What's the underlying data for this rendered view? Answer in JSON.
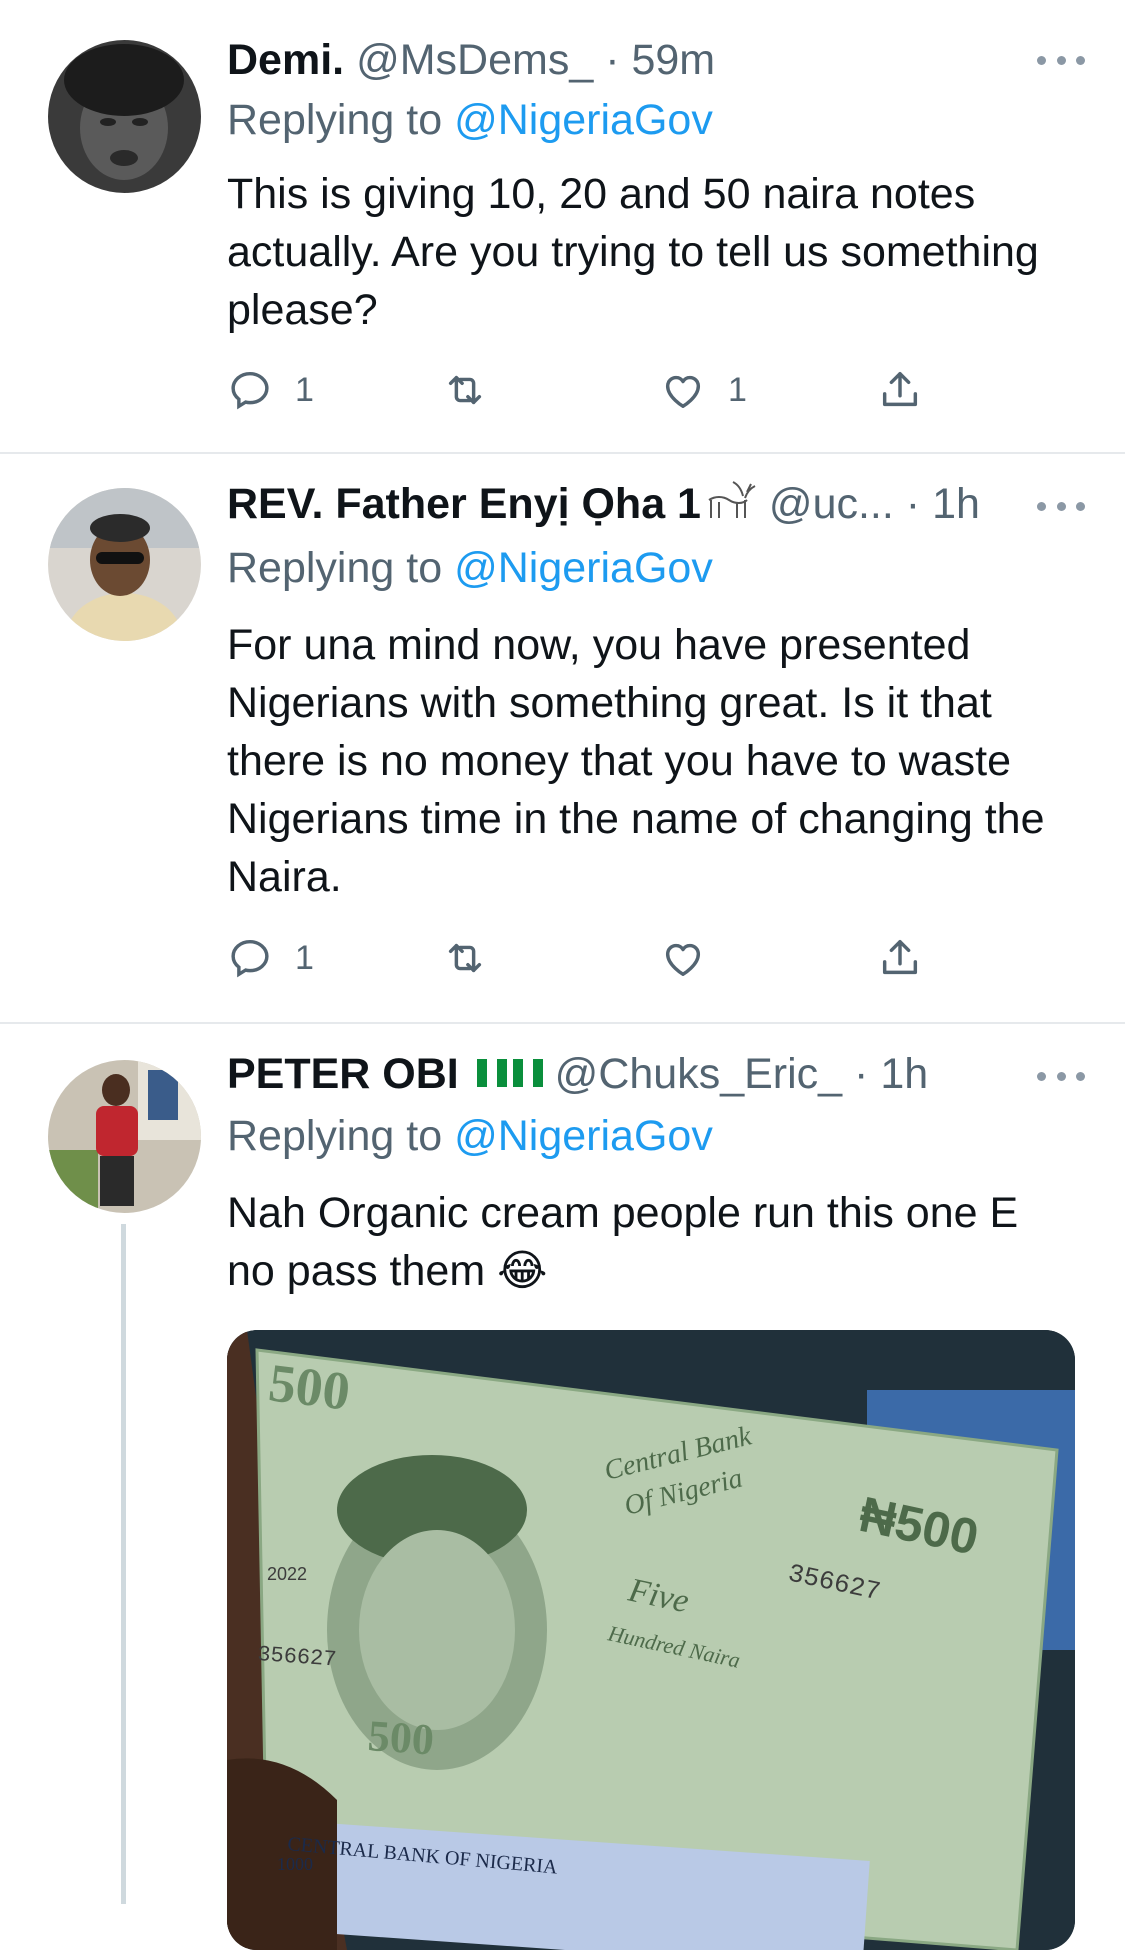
{
  "tweets": [
    {
      "name": "Demi.",
      "handle": "@MsDems_",
      "time": "59m",
      "replying_prefix": "Replying to ",
      "replying_to": "@NigeriaGov",
      "text": "This is giving 10, 20 and 50 naira notes actually. Are you trying to tell us something please?",
      "replies": "1",
      "retweets": "",
      "likes": "1"
    },
    {
      "name": "REV. Father Enyị Ọha 1",
      "handle": "@uc...",
      "time": "1h",
      "replying_prefix": "Replying to ",
      "replying_to": "@NigeriaGov",
      "text": "For una mind now, you have presented Nigerians with something great. Is it that there is no money that you have to waste Nigerians time in the name of changing the Naira.",
      "replies": "1",
      "retweets": "",
      "likes": ""
    },
    {
      "name": "PETER OBI",
      "handle": "@Chuks_Eric_",
      "time": "1h",
      "replying_prefix": "Replying to ",
      "replying_to": "@NigeriaGov",
      "text": "Nah Organic cream people run this one E no pass them 😂",
      "media": {
        "note_denomination": "₦500",
        "note_big_number": "500",
        "bank_name_line1": "Central Bank",
        "bank_name_line2": "Of Nigeria",
        "note_words_1": "Five",
        "note_words_2": "Hundred Naira",
        "year": "2022",
        "serial": "356627",
        "bottom_bank": "CENTRAL BANK OF NIGERIA",
        "bottom_value": "1000"
      }
    }
  ],
  "icons": [
    "reply-icon",
    "retweet-icon",
    "like-icon",
    "share-icon",
    "more-icon",
    "goat-emoji-icon",
    "nigeria-flag-icon"
  ]
}
